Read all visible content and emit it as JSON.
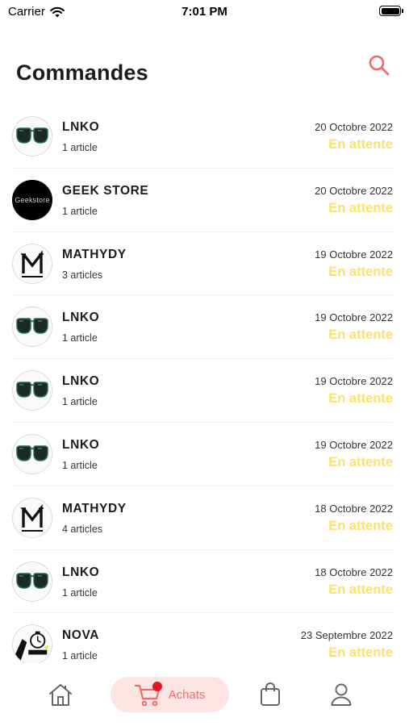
{
  "status_bar": {
    "carrier": "Carrier",
    "time": "7:01 PM"
  },
  "header": {
    "title": "Commandes"
  },
  "orders": [
    {
      "store": "LNKO",
      "items": "1 article",
      "date": "20 Octobre 2022",
      "status": "En attente",
      "logo": "sunglasses"
    },
    {
      "store": "GEEK STORE",
      "items": "1 article",
      "date": "20 Octobre 2022",
      "status": "En attente",
      "logo": "geekstore",
      "logo_text": "Geekstore"
    },
    {
      "store": "MATHYDY",
      "items": "3 articles",
      "date": "19 Octobre 2022",
      "status": "En attente",
      "logo": "mathydy"
    },
    {
      "store": "LNKO",
      "items": "1 article",
      "date": "19 Octobre 2022",
      "status": "En attente",
      "logo": "sunglasses"
    },
    {
      "store": "LNKO",
      "items": "1 article",
      "date": "19 Octobre 2022",
      "status": "En attente",
      "logo": "sunglasses"
    },
    {
      "store": "LNKO",
      "items": "1 article",
      "date": "19 Octobre 2022",
      "status": "En attente",
      "logo": "sunglasses"
    },
    {
      "store": "MATHYDY",
      "items": "4 articles",
      "date": "18 Octobre 2022",
      "status": "En attente",
      "logo": "mathydy"
    },
    {
      "store": "LNKO",
      "items": "1 article",
      "date": "18 Octobre 2022",
      "status": "En attente",
      "logo": "sunglasses"
    },
    {
      "store": "NOVA",
      "items": "1 article",
      "date": "23 Septembre 2022",
      "status": "En attente",
      "logo": "nova"
    }
  ],
  "tab_bar": {
    "achats_label": "Achats",
    "active_tab": "achats"
  },
  "colors": {
    "accent": "#ef6c6a",
    "status_pending": "#ffe06b",
    "active_tab_bg": "#fde5e4",
    "badge": "#e6141f"
  },
  "icons": {
    "search": "search-icon",
    "home": "home-icon",
    "cart": "cart-icon",
    "bag": "shopping-bag-icon",
    "profile": "user-icon"
  }
}
